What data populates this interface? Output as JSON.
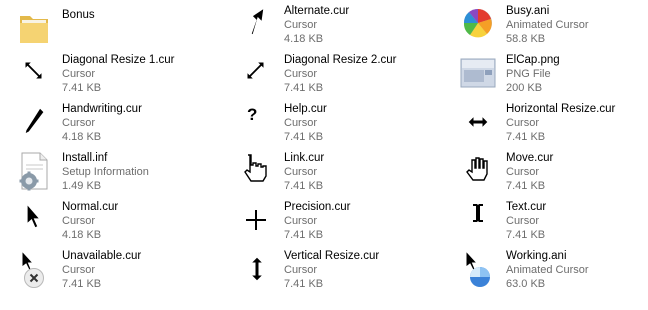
{
  "files": [
    {
      "name": "Bonus",
      "type": "",
      "size": "",
      "icon": "folder-icon"
    },
    {
      "name": "Alternate.cur",
      "type": "Cursor",
      "size": "4.18 KB",
      "icon": "alternate-cursor-icon"
    },
    {
      "name": "Busy.ani",
      "type": "Animated Cursor",
      "size": "58.8 KB",
      "icon": "busy-cursor-icon"
    },
    {
      "name": "Diagonal Resize 1.cur",
      "type": "Cursor",
      "size": "7.41 KB",
      "icon": "diagonal-resize-1-icon"
    },
    {
      "name": "Diagonal Resize 2.cur",
      "type": "Cursor",
      "size": "7.41 KB",
      "icon": "diagonal-resize-2-icon"
    },
    {
      "name": "ElCap.png",
      "type": "PNG File",
      "size": "200 KB",
      "icon": "image-thumbnail-icon"
    },
    {
      "name": "Handwriting.cur",
      "type": "Cursor",
      "size": "4.18 KB",
      "icon": "handwriting-cursor-icon"
    },
    {
      "name": "Help.cur",
      "type": "Cursor",
      "size": "7.41 KB",
      "icon": "help-cursor-icon"
    },
    {
      "name": "Horizontal Resize.cur",
      "type": "Cursor",
      "size": "7.41 KB",
      "icon": "horizontal-resize-icon"
    },
    {
      "name": "Install.inf",
      "type": "Setup Information",
      "size": "1.49 KB",
      "icon": "setup-info-icon"
    },
    {
      "name": "Link.cur",
      "type": "Cursor",
      "size": "7.41 KB",
      "icon": "link-hand-cursor-icon"
    },
    {
      "name": "Move.cur",
      "type": "Cursor",
      "size": "7.41 KB",
      "icon": "move-hand-cursor-icon"
    },
    {
      "name": "Normal.cur",
      "type": "Cursor",
      "size": "4.18 KB",
      "icon": "normal-arrow-cursor-icon"
    },
    {
      "name": "Precision.cur",
      "type": "Cursor",
      "size": "7.41 KB",
      "icon": "precision-crosshair-icon"
    },
    {
      "name": "Text.cur",
      "type": "Cursor",
      "size": "7.41 KB",
      "icon": "text-ibeam-cursor-icon"
    },
    {
      "name": "Unavailable.cur",
      "type": "Cursor",
      "size": "7.41 KB",
      "icon": "unavailable-cursor-icon"
    },
    {
      "name": "Vertical Resize.cur",
      "type": "Cursor",
      "size": "7.41 KB",
      "icon": "vertical-resize-icon"
    },
    {
      "name": "Working.ani",
      "type": "Animated Cursor",
      "size": "63.0 KB",
      "icon": "working-cursor-icon"
    }
  ]
}
